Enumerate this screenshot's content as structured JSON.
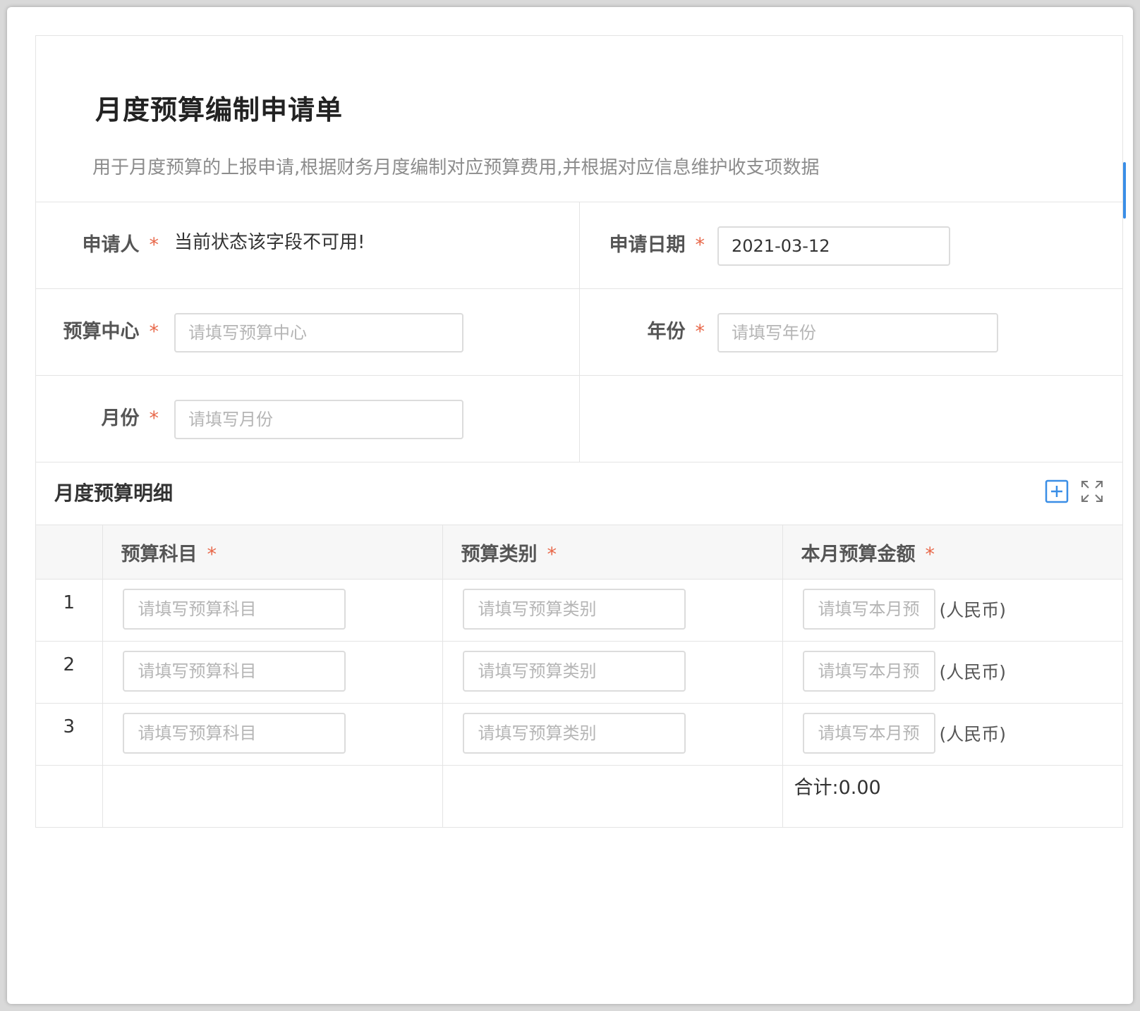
{
  "form": {
    "title": "月度预算编制申请单",
    "description": "用于月度预算的上报申请,根据财务月度编制对应预算费用,并根据对应信息维护收支项数据"
  },
  "fields": {
    "applicant": {
      "label": "申请人",
      "required_mark": "*",
      "value": "当前状态该字段不可用!"
    },
    "apply_date": {
      "label": "申请日期",
      "required_mark": "*",
      "value": "2021-03-12"
    },
    "budget_center": {
      "label": "预算中心",
      "required_mark": "*",
      "placeholder": "请填写预算中心"
    },
    "year": {
      "label": "年份",
      "required_mark": "*",
      "placeholder": "请填写年份"
    },
    "month": {
      "label": "月份",
      "required_mark": "*",
      "placeholder": "请填写月份"
    }
  },
  "detail": {
    "title": "月度预算明细",
    "icons": {
      "add": "add-square-icon",
      "expand": "fullscreen-expand-icon"
    },
    "columns": [
      {
        "label": "预算科目",
        "required_mark": "*"
      },
      {
        "label": "预算类别",
        "required_mark": "*"
      },
      {
        "label": "本月预算金额",
        "required_mark": "*"
      }
    ],
    "rows": [
      {
        "index": "1",
        "subject_placeholder": "请填写预算科目",
        "category_placeholder": "请填写预算类别",
        "amount_placeholder": "请填写本月预算金额",
        "unit": "(人民币)"
      },
      {
        "index": "2",
        "subject_placeholder": "请填写预算科目",
        "category_placeholder": "请填写预算类别",
        "amount_placeholder": "请填写本月预算金额",
        "unit": "(人民币)"
      },
      {
        "index": "3",
        "subject_placeholder": "请填写预算科目",
        "category_placeholder": "请填写预算类别",
        "amount_placeholder": "请填写本月预算金额",
        "unit": "(人民币)"
      }
    ],
    "total": "合计:0.00"
  },
  "colors": {
    "required": "#e8684a",
    "accent": "#3a8ee6",
    "border": "#e4e4e4"
  }
}
